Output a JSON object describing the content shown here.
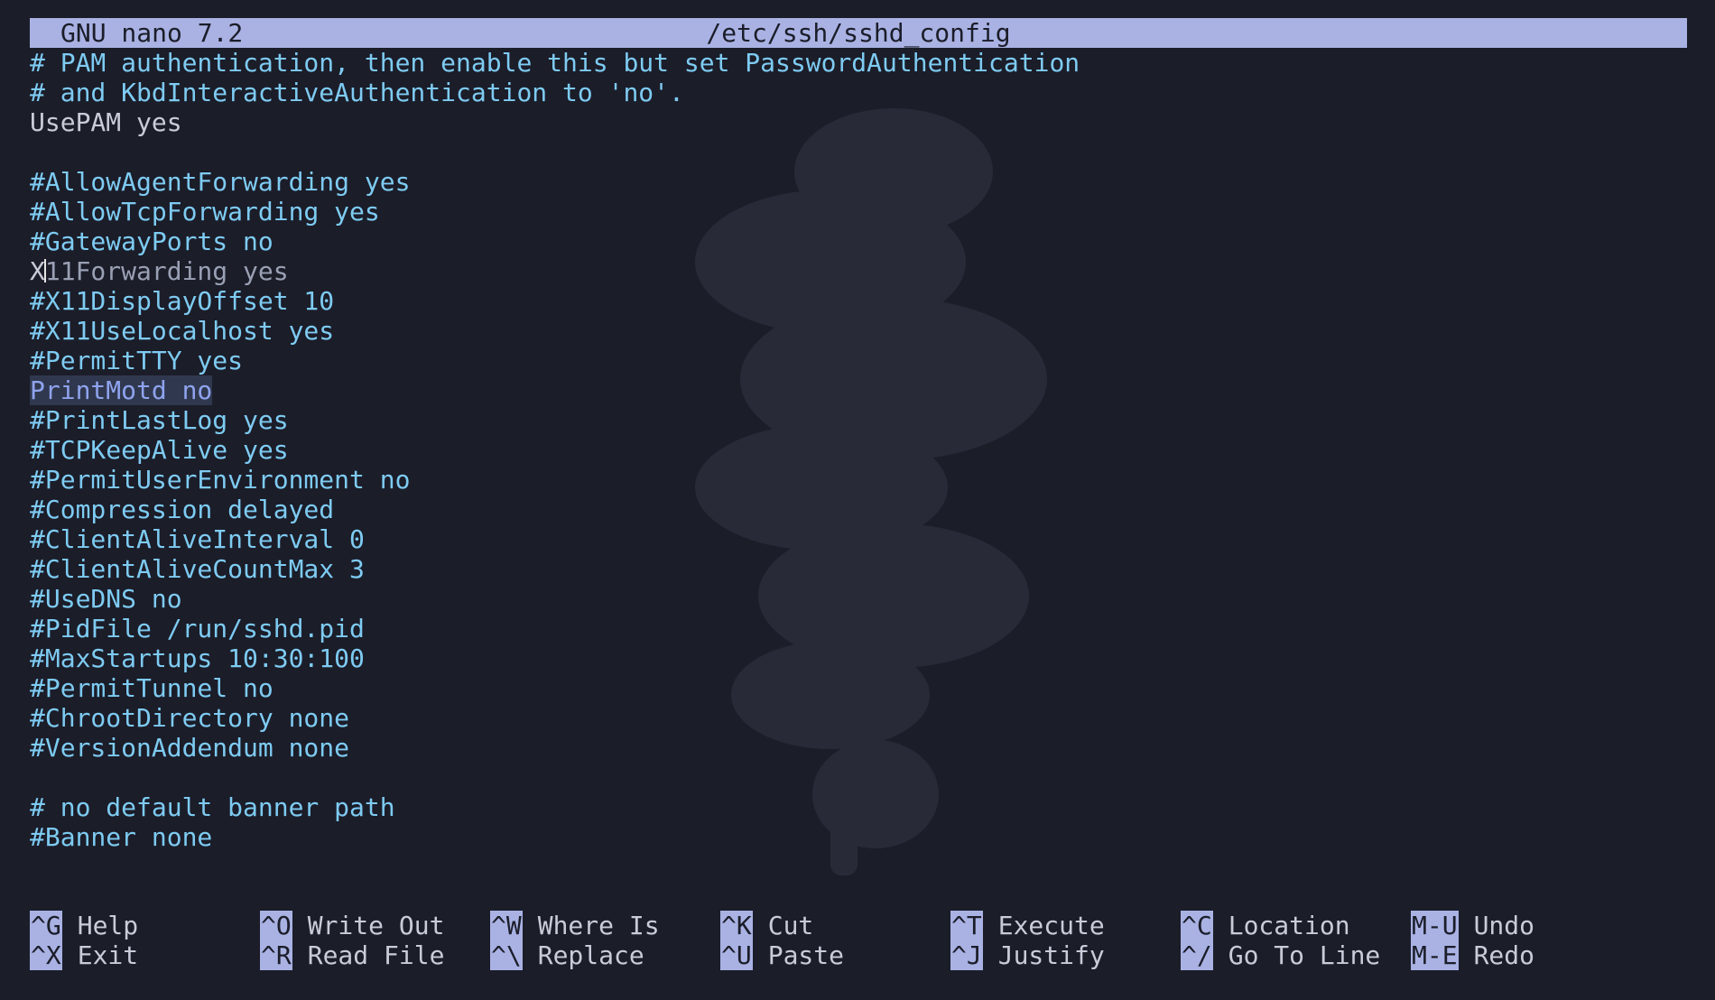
{
  "app": {
    "name_version": "GNU nano 7.2",
    "filename": "/etc/ssh/sshd_config"
  },
  "editor": {
    "lines": [
      {
        "text": "# PAM authentication, then enable this but set PasswordAuthentication",
        "kind": "comment"
      },
      {
        "text": "# and KbdInteractiveAuthentication to 'no'.",
        "kind": "comment"
      },
      {
        "text": "UsePAM yes",
        "kind": "setting"
      },
      {
        "text": "",
        "kind": "blank"
      },
      {
        "text": "#AllowAgentForwarding yes",
        "kind": "comment"
      },
      {
        "text": "#AllowTcpForwarding yes",
        "kind": "comment"
      },
      {
        "text": "#GatewayPorts no",
        "kind": "comment"
      },
      {
        "text": "X11Forwarding yes",
        "kind": "cursor"
      },
      {
        "text": "#X11DisplayOffset 10",
        "kind": "comment"
      },
      {
        "text": "#X11UseLocalhost yes",
        "kind": "comment"
      },
      {
        "text": "#PermitTTY yes",
        "kind": "comment"
      },
      {
        "text": "PrintMotd no",
        "kind": "selected"
      },
      {
        "text": "#PrintLastLog yes",
        "kind": "comment"
      },
      {
        "text": "#TCPKeepAlive yes",
        "kind": "comment"
      },
      {
        "text": "#PermitUserEnvironment no",
        "kind": "comment"
      },
      {
        "text": "#Compression delayed",
        "kind": "comment"
      },
      {
        "text": "#ClientAliveInterval 0",
        "kind": "comment"
      },
      {
        "text": "#ClientAliveCountMax 3",
        "kind": "comment"
      },
      {
        "text": "#UseDNS no",
        "kind": "comment"
      },
      {
        "text": "#PidFile /run/sshd.pid",
        "kind": "comment"
      },
      {
        "text": "#MaxStartups 10:30:100",
        "kind": "comment"
      },
      {
        "text": "#PermitTunnel no",
        "kind": "comment"
      },
      {
        "text": "#ChrootDirectory none",
        "kind": "comment"
      },
      {
        "text": "#VersionAddendum none",
        "kind": "comment"
      },
      {
        "text": "",
        "kind": "blank"
      },
      {
        "text": "# no default banner path",
        "kind": "comment"
      },
      {
        "text": "#Banner none",
        "kind": "comment"
      }
    ],
    "cursor": {
      "line": 8,
      "column": 2
    }
  },
  "shortcuts": {
    "row1": [
      {
        "key": "^G",
        "label": "Help"
      },
      {
        "key": "^O",
        "label": "Write Out"
      },
      {
        "key": "^W",
        "label": "Where Is"
      },
      {
        "key": "^K",
        "label": "Cut"
      },
      {
        "key": "^T",
        "label": "Execute"
      },
      {
        "key": "^C",
        "label": "Location"
      },
      {
        "key": "M-U",
        "label": "Undo"
      }
    ],
    "row2": [
      {
        "key": "^X",
        "label": "Exit"
      },
      {
        "key": "^R",
        "label": "Read File"
      },
      {
        "key": "^\\",
        "label": "Replace"
      },
      {
        "key": "^U",
        "label": "Paste"
      },
      {
        "key": "^J",
        "label": "Justify"
      },
      {
        "key": "^/",
        "label": "Go To Line"
      },
      {
        "key": "M-E",
        "label": "Redo"
      }
    ]
  },
  "theme": {
    "background": "#1b1d29",
    "title_bar": "#a9b2e3",
    "comment_color": "#7ecbf2",
    "text_color": "#c9ccd8",
    "selection_color": "#8fa3ee"
  },
  "decorations": {
    "watermark": "dragon-watermark-icon"
  }
}
